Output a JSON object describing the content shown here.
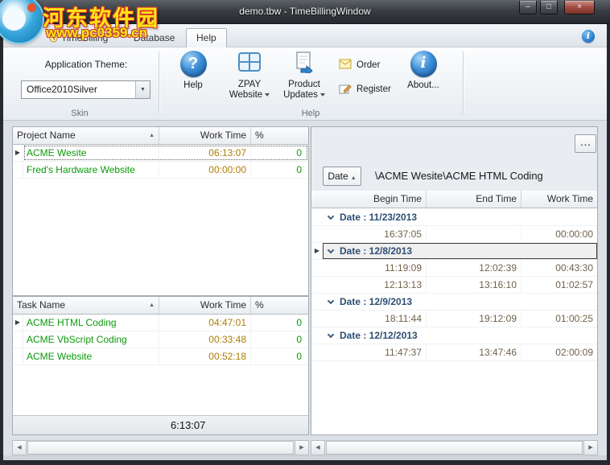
{
  "window": {
    "title": "demo.tbw - TimeBillingWindow"
  },
  "watermark": {
    "site_name": "河东软件园",
    "site_url": "www.pc0359.cn"
  },
  "icons": {
    "minimize": "–",
    "maximize": "□",
    "close": "×",
    "info": "i",
    "help": "?",
    "about": "i",
    "dropdown": "▼",
    "sort_asc": "▲",
    "row_marker": "▶",
    "scroll_left": "◀",
    "scroll_right": "▶",
    "more": "…"
  },
  "ribbon": {
    "tabs": [
      {
        "label": "TimeBilling"
      },
      {
        "label": "Database"
      },
      {
        "label": "Help"
      }
    ],
    "skin_group": {
      "caption": "Skin",
      "theme_label": "Application Theme:",
      "theme_value": "Office2010Silver"
    },
    "help_group": {
      "caption": "Help",
      "help_label": "Help",
      "zpay_line1": "ZPAY",
      "zpay_line2": "Website",
      "updates_line1": "Product",
      "updates_line2": "Updates",
      "order_label": "Order",
      "register_label": "Register",
      "about_label": "About..."
    }
  },
  "projects_table": {
    "columns": [
      "Project Name",
      "Work Time",
      "%"
    ],
    "rows": [
      {
        "name": "ACME Wesite",
        "work_time": "06:13:07",
        "pct": "0",
        "marker": true,
        "focused": true
      },
      {
        "name": "Fred's Hardware Website",
        "work_time": "00:00:00",
        "pct": "0",
        "marker": false,
        "focused": false
      }
    ]
  },
  "tasks_table": {
    "columns": [
      "Task Name",
      "Work Time",
      "%"
    ],
    "rows": [
      {
        "name": "ACME HTML Coding",
        "work_time": "04:47:01",
        "pct": "0",
        "marker": true,
        "focused": false
      },
      {
        "name": "ACME VbScript Coding",
        "work_time": "00:33:48",
        "pct": "0",
        "marker": false,
        "focused": false
      },
      {
        "name": "ACME Website",
        "work_time": "00:52:18",
        "pct": "0",
        "marker": false,
        "focused": false
      }
    ],
    "footer_total": "6:13:07"
  },
  "detail_panel": {
    "group_button_label": "Date",
    "path": "\\ACME Wesite\\ACME HTML Coding",
    "columns": [
      "Begin Time",
      "End Time",
      "Work Time"
    ],
    "groups": [
      {
        "label": "Date : 11/23/2013",
        "selected": false,
        "rows": [
          {
            "begin": "16:37:05",
            "end": "",
            "work": "00:00:00"
          }
        ]
      },
      {
        "label": "Date : 12/8/2013",
        "selected": true,
        "rows": [
          {
            "begin": "11:19:09",
            "end": "12:02:39",
            "work": "00:43:30"
          },
          {
            "begin": "12:13:13",
            "end": "13:16:10",
            "work": "01:02:57"
          }
        ]
      },
      {
        "label": "Date : 12/9/2013",
        "selected": false,
        "rows": [
          {
            "begin": "18:11:44",
            "end": "19:12:09",
            "work": "01:00:25"
          }
        ]
      },
      {
        "label": "Date : 12/12/2013",
        "selected": false,
        "rows": [
          {
            "begin": "11:47:37",
            "end": "13:47:46",
            "work": "02:00:09"
          }
        ]
      }
    ]
  }
}
